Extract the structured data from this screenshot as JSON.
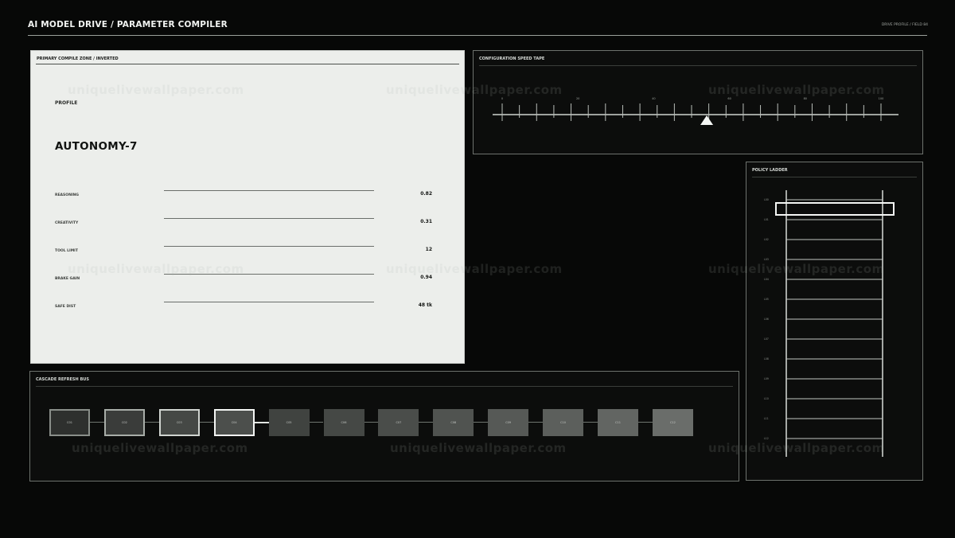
{
  "header": {
    "title": "AI MODEL DRIVE / PARAMETER COMPILER",
    "meta": "DRIVE PROFILE / FIELD 84"
  },
  "primary": {
    "title": "PRIMARY COMPILE ZONE / INVERTED",
    "profile_label": "PROFILE",
    "profile_name": "AUTONOMY-7",
    "params": [
      {
        "label": "REASONING",
        "value": "0.82"
      },
      {
        "label": "CREATIVITY",
        "value": "0.31"
      },
      {
        "label": "TOOL LIMIT",
        "value": "12"
      },
      {
        "label": "BRAKE GAIN",
        "value": "0.94"
      },
      {
        "label": "SAFE DIST",
        "value": "48 tk"
      }
    ]
  },
  "tape": {
    "title": "CONFIGURATION SPEED TAPE",
    "tick_labels": [
      "0",
      "20",
      "40",
      "60",
      "80",
      "100"
    ],
    "marker_fraction": 0.54
  },
  "ladder": {
    "title": "POLICY LADDER",
    "rungs": [
      "L00",
      "L01",
      "L02",
      "L03",
      "L04",
      "L05",
      "L06",
      "L07",
      "L08",
      "L09",
      "L10",
      "L11",
      "L12"
    ],
    "selected_index": 0
  },
  "bus": {
    "title": "CASCADE REFRESH BUS",
    "nodes": [
      "C01",
      "C02",
      "C03",
      "C04",
      "C05",
      "C06",
      "C07",
      "C08",
      "C09",
      "C10",
      "C11",
      "C12"
    ]
  },
  "watermark": "uniquelivewallpaper.com",
  "colors": {
    "background": "#070807",
    "panel_light": "#eceeeb",
    "panel_dark": "#0c0d0c",
    "border": "#6d726d"
  }
}
